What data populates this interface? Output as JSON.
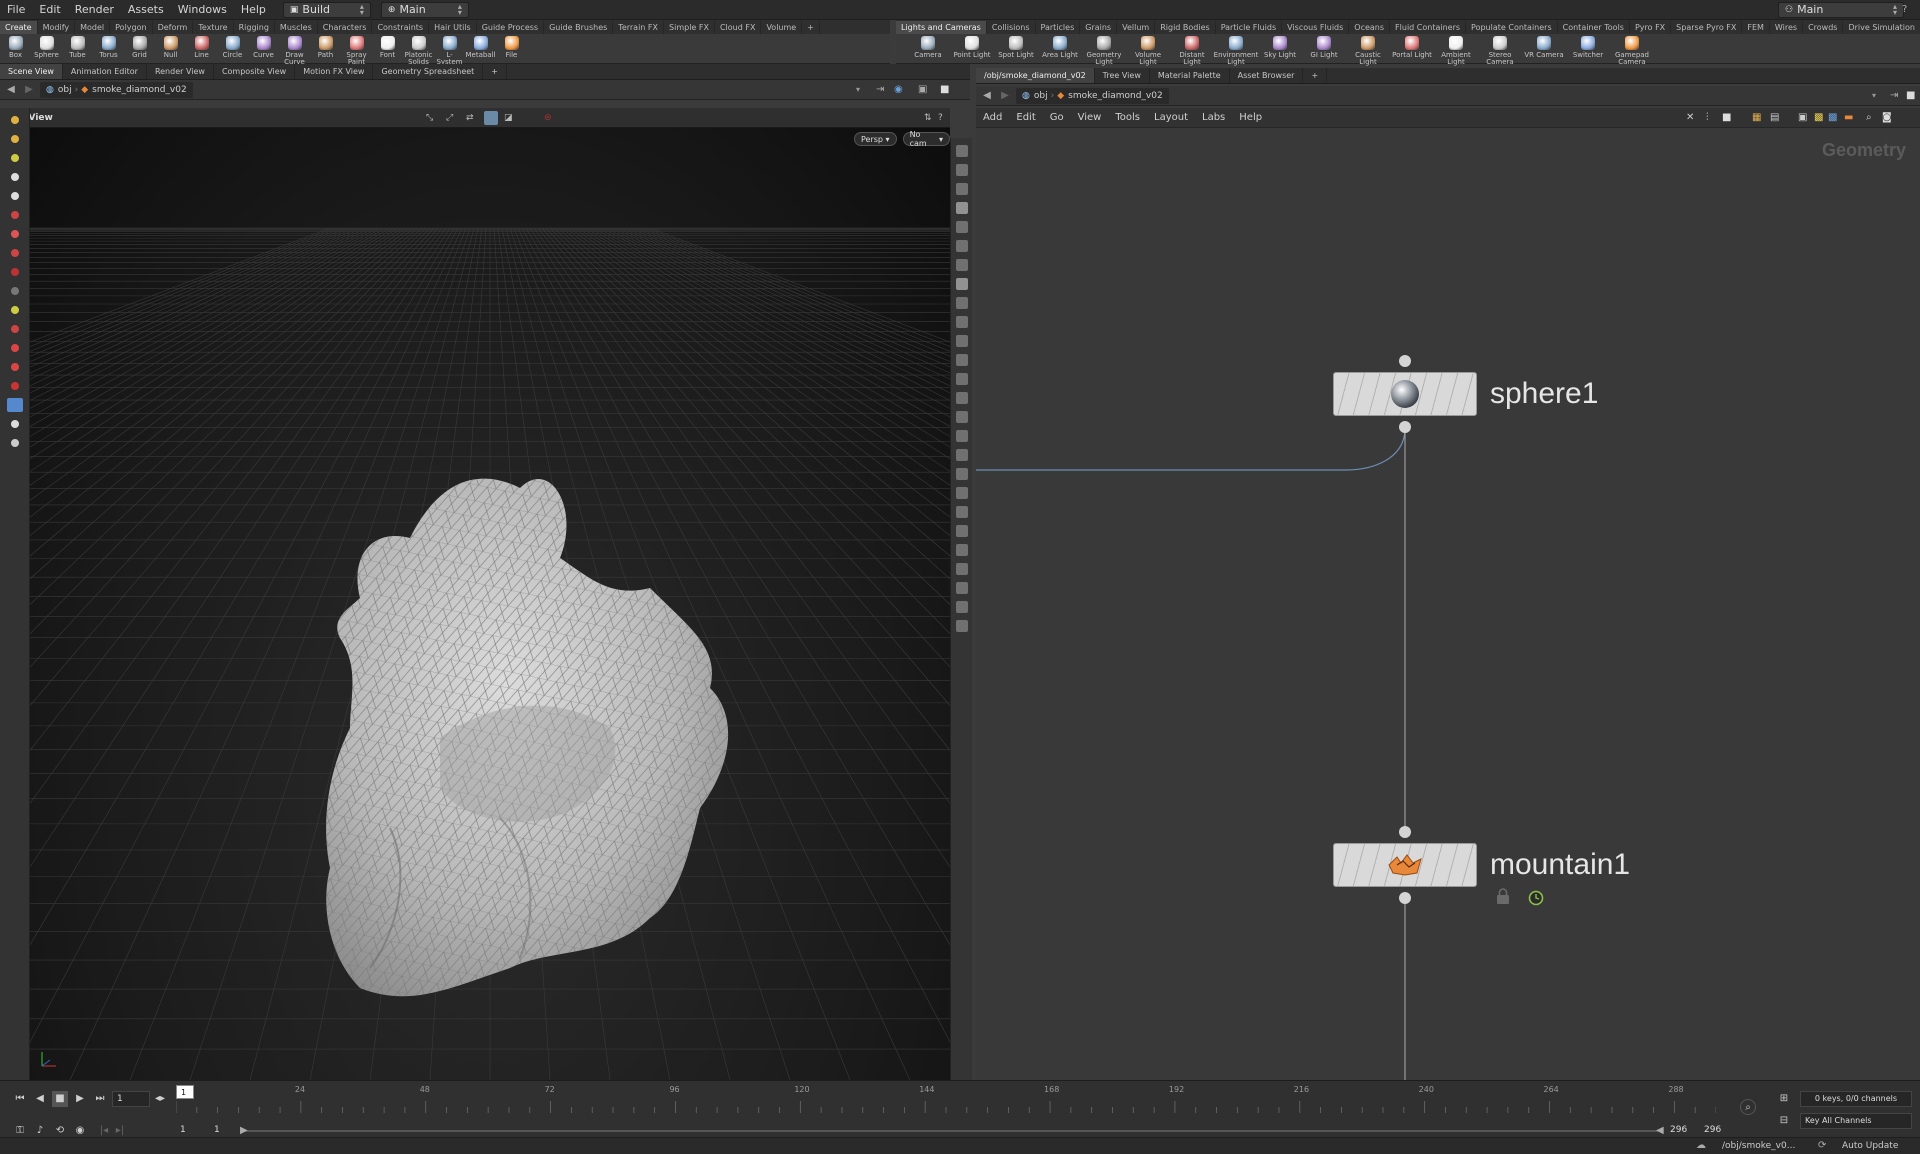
{
  "menubar": {
    "items": [
      "File",
      "Edit",
      "Render",
      "Assets",
      "Windows",
      "Help"
    ],
    "desktop": "Build",
    "network_level": "Main",
    "right_desktop": "Main"
  },
  "shelf_left": {
    "tabs": [
      "Create",
      "Modify",
      "Model",
      "Polygon",
      "Deform",
      "Texture",
      "Rigging",
      "Muscles",
      "Characters",
      "Constraints",
      "Hair Utils",
      "Guide Process",
      "Guide Brushes",
      "Terrain FX",
      "Simple FX",
      "Cloud FX",
      "Volume",
      "+"
    ],
    "tools": [
      "Box",
      "Sphere",
      "Tube",
      "Torus",
      "Grid",
      "Null",
      "Line",
      "Circle",
      "Curve",
      "Draw Curve",
      "Path",
      "Spray Paint",
      "Font",
      "Platonic Solids",
      "L-System",
      "Metaball",
      "File"
    ]
  },
  "shelf_right": {
    "tabs": [
      "Lights and Cameras",
      "Collisions",
      "Particles",
      "Grains",
      "Vellum",
      "Rigid Bodies",
      "Particle Fluids",
      "Viscous Fluids",
      "Oceans",
      "Fluid Containers",
      "Populate Containers",
      "Container Tools",
      "Pyro FX",
      "Sparse Pyro FX",
      "FEM",
      "Wires",
      "Crowds",
      "Drive Simulation",
      "+"
    ],
    "tools": [
      "Camera",
      "Point Light",
      "Spot Light",
      "Area Light",
      "Geometry Light",
      "Volume Light",
      "Distant Light",
      "Environment Light",
      "Sky Light",
      "GI Light",
      "Caustic Light",
      "Portal Light",
      "Ambient Light",
      "Stereo Camera",
      "VR Camera",
      "Switcher",
      "Gamepad Camera"
    ]
  },
  "left_pane": {
    "tabs": [
      "Scene View",
      "Animation Editor",
      "Render View",
      "Composite View",
      "Motion FX View",
      "Geometry Spreadsheet",
      "+"
    ],
    "path": [
      "obj",
      "smoke_diamond_v02"
    ],
    "view_label": "View",
    "persp": "Persp",
    "cam": "No cam"
  },
  "right_pane": {
    "tabs": [
      "/obj/smoke_diamond_v02",
      "Tree View",
      "Material Palette",
      "Asset Browser",
      "+"
    ],
    "path": [
      "obj",
      "smoke_diamond_v02"
    ],
    "menu": [
      "Add",
      "Edit",
      "Go",
      "View",
      "Tools",
      "Layout",
      "Labs",
      "Help"
    ],
    "context": "Geometry",
    "nodes": [
      {
        "name": "sphere1",
        "type": "sphere"
      },
      {
        "name": "mountain1",
        "type": "mountain"
      }
    ]
  },
  "timeline": {
    "frame": "1",
    "start": "1",
    "start2": "1",
    "end": "296",
    "end2": "296",
    "marker": "1",
    "ticks": [
      "24",
      "48",
      "72",
      "96",
      "120",
      "144",
      "168",
      "192",
      "216",
      "240",
      "264",
      "288"
    ],
    "keys_info": "0 keys, 0/0 channels",
    "key_all": "Key All Channels",
    "status_path": "/obj/smoke_v0...",
    "auto_update": "Auto Update"
  },
  "colors": {
    "accent_orange": "#e8883a",
    "wire": "#6b8fb5"
  }
}
